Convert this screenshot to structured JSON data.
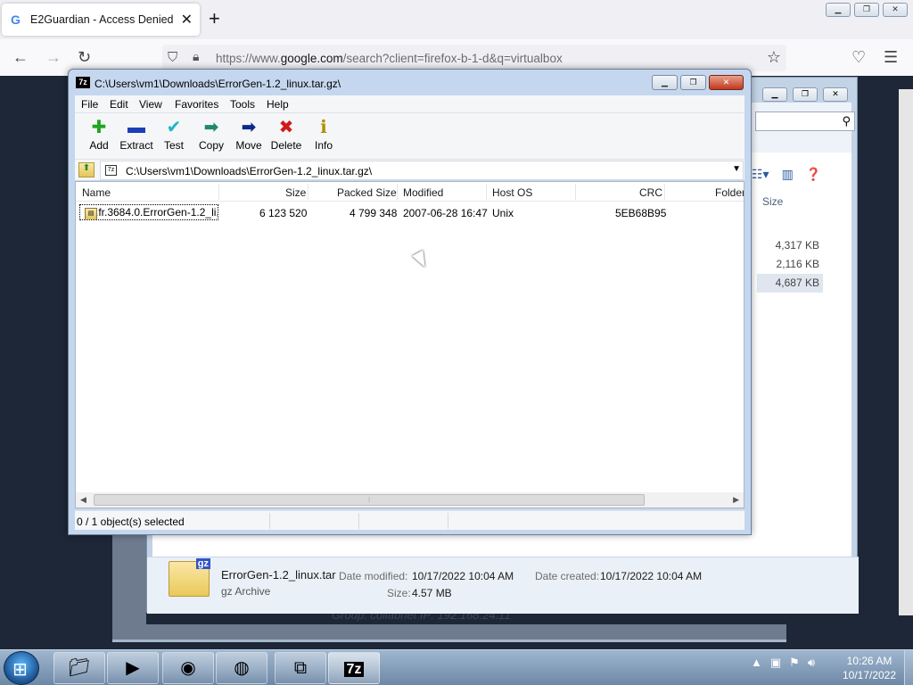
{
  "browser": {
    "tab_title": "E2Guardian - Access Denied",
    "tab_favicon": "G",
    "new_tab": "+",
    "url_prefix": "https://www.",
    "url_host": "google.com",
    "url_rest": "/search?client=firefox-b-1-d&q=virtualbox"
  },
  "sevenzip": {
    "title": "C:\\Users\\vm1\\Downloads\\ErrorGen-1.2_linux.tar.gz\\",
    "menu": [
      "File",
      "Edit",
      "View",
      "Favorites",
      "Tools",
      "Help"
    ],
    "toolbar": [
      {
        "label": "Add",
        "icon": "plus-icon",
        "glyph": "✚",
        "color": "#1fa51f"
      },
      {
        "label": "Extract",
        "icon": "minus-icon",
        "glyph": "▬",
        "color": "#1d3fb5"
      },
      {
        "label": "Test",
        "icon": "check-icon",
        "glyph": "✔",
        "color": "#1fb5c6"
      },
      {
        "label": "Copy",
        "icon": "copy-arrow-icon",
        "glyph": "➡",
        "color": "#1d8a6a"
      },
      {
        "label": "Move",
        "icon": "move-arrow-icon",
        "glyph": "➡",
        "color": "#0d2a8a"
      },
      {
        "label": "Delete",
        "icon": "delete-x-icon",
        "glyph": "✖",
        "color": "#d11a1a"
      },
      {
        "label": "Info",
        "icon": "info-icon",
        "glyph": "ℹ",
        "color": "#b09000"
      }
    ],
    "address": "C:\\Users\\vm1\\Downloads\\ErrorGen-1.2_linux.tar.gz\\",
    "columns": [
      "Name",
      "Size",
      "Packed Size",
      "Modified",
      "Host OS",
      "CRC",
      "Folder"
    ],
    "rows": [
      {
        "name": ".fr.3684.0.ErrorGen-1.2_li...",
        "size": "6 123 520",
        "packed": "4 799 348",
        "modified": "2007-06-28 16:47",
        "host": "Unix",
        "crc": "5EB68B95"
      }
    ],
    "status": "0 / 1 object(s) selected"
  },
  "explorer": {
    "size_header": "Size",
    "sizes": [
      "4,317 KB",
      "2,116 KB",
      "4,687 KB"
    ],
    "file_name": "ErrorGen-1.2_linux.tar",
    "file_type": "gz Archive",
    "modified_label": "Date modified:",
    "modified_value": "10/17/2022 10:04 AM",
    "created_label": "Date created:",
    "created_value": "10/17/2022 10:04 AM",
    "size_label": "Size:",
    "size_value": "4.57 MB",
    "big_icon_badge": "gz"
  },
  "background_text": "Group: collabnet   IP: 192.168.24.11",
  "taskbar": {
    "time": "10:26 AM",
    "date": "10/17/2022"
  }
}
